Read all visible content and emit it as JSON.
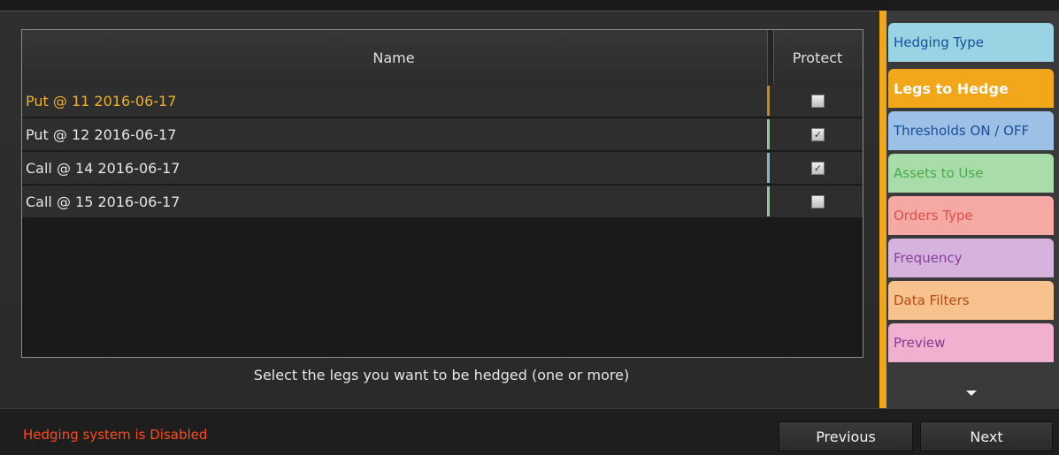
{
  "table": {
    "headers": {
      "name": "Name",
      "protect": "Protect"
    },
    "rows": [
      {
        "label": "Put @ 11 2016-06-17",
        "protected": false,
        "text_color": "#f0b030",
        "marker_color": "#c98a14"
      },
      {
        "label": "Put @ 12 2016-06-17",
        "protected": true,
        "text_color": "#e6e6e6",
        "marker_color": "#8fc9a0"
      },
      {
        "label": "Call @ 14 2016-06-17",
        "protected": true,
        "text_color": "#e6e6e6",
        "marker_color": "#7ab8d8"
      },
      {
        "label": "Call @ 15 2016-06-17",
        "protected": false,
        "text_color": "#e6e6e6",
        "marker_color": "#8fc9a0"
      }
    ],
    "checked_glyph": "✓"
  },
  "hint": "Select the legs you want to be hedged (one or more)",
  "sidebar": {
    "tabs": [
      {
        "label": "Hedging Type",
        "bg": "#9ad4e4",
        "color": "#1c4f9a",
        "active": false
      },
      {
        "label": "Legs to Hedge",
        "bg": "#f2a619",
        "color": "#ffffff",
        "active": true
      },
      {
        "label": "Thresholds ON / OFF",
        "bg": "#9cc0e6",
        "color": "#1c4f9a",
        "active": false
      },
      {
        "label": "Assets to Use",
        "bg": "#a8dca8",
        "color": "#4caa4c",
        "active": false
      },
      {
        "label": "Orders Type",
        "bg": "#f4a9a4",
        "color": "#e0504a",
        "active": false
      },
      {
        "label": "Frequency",
        "bg": "#d6b3dd",
        "color": "#8a3fa0",
        "active": false
      },
      {
        "label": "Data Filters",
        "bg": "#f7c28e",
        "color": "#b84a10",
        "active": false
      },
      {
        "label": "Preview",
        "bg": "#f0b0d0",
        "color": "#8a3a8a",
        "active": false
      }
    ],
    "more_icon": "chevron-down"
  },
  "footer": {
    "status": "Hedging system is Disabled",
    "previous_label": "Previous",
    "next_label": "Next"
  }
}
